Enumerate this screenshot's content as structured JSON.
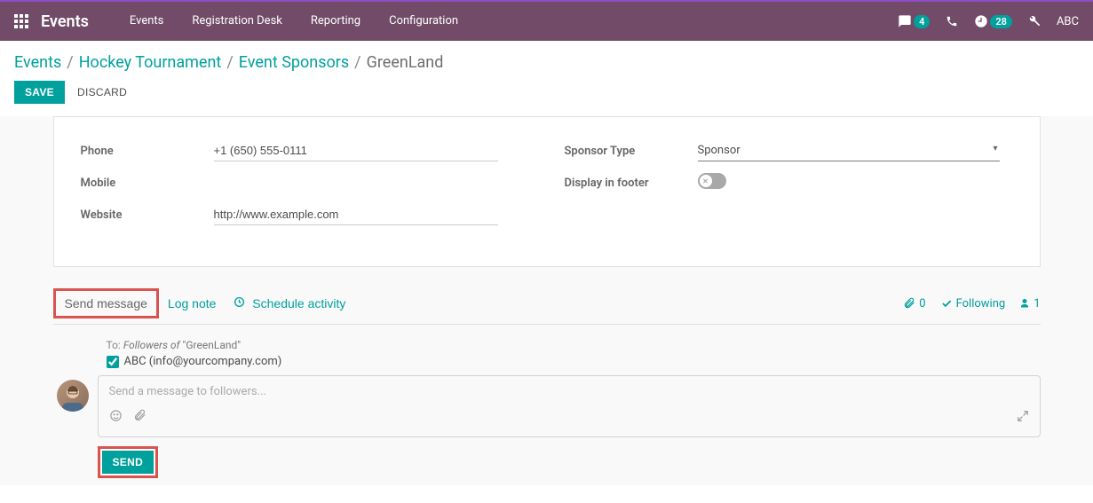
{
  "topbar": {
    "brand": "Events",
    "menu": [
      "Events",
      "Registration Desk",
      "Reporting",
      "Configuration"
    ],
    "messages_count": "4",
    "activities_count": "28",
    "user": "ABC"
  },
  "breadcrumb": {
    "items": [
      "Events",
      "Hockey Tournament",
      "Event Sponsors"
    ],
    "current": "GreenLand"
  },
  "buttons": {
    "save": "SAVE",
    "discard": "DISCARD"
  },
  "form": {
    "left": {
      "phone_label": "Phone",
      "phone_value": "+1 (650) 555-0111",
      "mobile_label": "Mobile",
      "mobile_value": "",
      "website_label": "Website",
      "website_value": "http://www.example.com"
    },
    "right": {
      "sponsor_type_label": "Sponsor Type",
      "sponsor_type_value": "Sponsor",
      "display_footer_label": "Display in footer",
      "display_footer_on": false
    }
  },
  "chatter": {
    "tabs": {
      "send_message": "Send message",
      "log_note": "Log note",
      "schedule_activity": "Schedule activity"
    },
    "indicators": {
      "attachments_count": "0",
      "following_label": "Following",
      "followers_count": "1"
    },
    "composer": {
      "to_label": "To:",
      "to_followers_of": "Followers of ",
      "to_record": "\"GreenLand\"",
      "recipient_name": "ABC (info@yourcompany.com)",
      "recipient_checked": true,
      "placeholder": "Send a message to followers...",
      "send": "SEND"
    }
  }
}
